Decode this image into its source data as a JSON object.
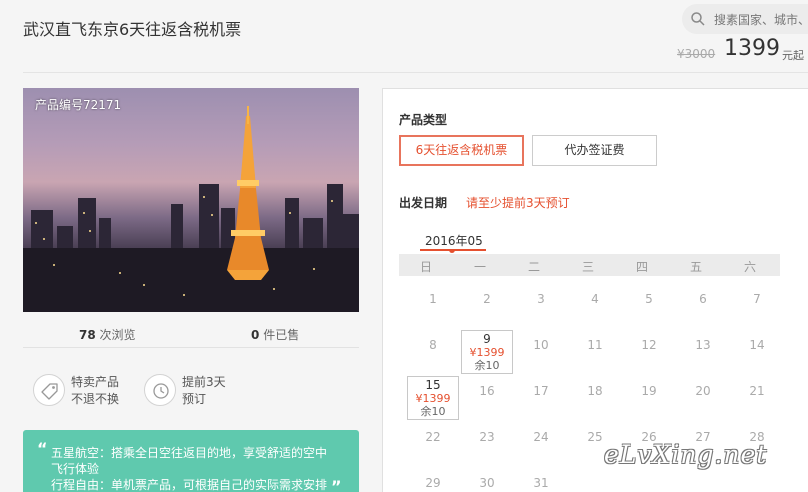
{
  "header": {
    "title": "武汉直飞东京6天往返含税机票",
    "search_placeholder": "搜素国家、城市、",
    "old_price": "¥3000",
    "price": "1399",
    "price_suffix": "元起"
  },
  "product": {
    "code_label": "产品编号72171",
    "views_count": "78",
    "views_label": "次浏览",
    "sold_count": "0",
    "sold_label": "件已售",
    "features": [
      {
        "icon": "tag-icon",
        "line1": "特卖产品",
        "line2": "不退不换"
      },
      {
        "icon": "clock-icon",
        "line1": "提前3天",
        "line2": "预订"
      }
    ],
    "promo": {
      "line1": "五星航空：搭乘全日空往返目的地，享受舒适的空中",
      "line2": "飞行体验",
      "line3": "行程自由：单机票产品，可根据自己的实际需求安排"
    }
  },
  "booking": {
    "type_label": "产品类型",
    "options": [
      "6天往返含税机票",
      "代办签证费"
    ],
    "selected_option": 0,
    "date_label": "出发日期",
    "date_notice": "请至少提前3天预订",
    "month": "2016年05",
    "weekdays": [
      "日",
      "一",
      "二",
      "三",
      "四",
      "五",
      "六"
    ],
    "rows": [
      [
        "1",
        "2",
        "3",
        "4",
        "5",
        "6",
        "7"
      ],
      [
        "8",
        "9",
        "10",
        "11",
        "12",
        "13",
        "14"
      ],
      [
        "15",
        "16",
        "17",
        "18",
        "19",
        "20",
        "21"
      ],
      [
        "22",
        "23",
        "24",
        "25",
        "26",
        "27",
        "28"
      ],
      [
        "29",
        "30",
        "31"
      ]
    ],
    "available": [
      {
        "day": "9",
        "price": "¥1399",
        "remain": "余10"
      },
      {
        "day": "15",
        "price": "¥1399",
        "remain": "余10"
      }
    ]
  },
  "watermark": "eLvXing.net",
  "colors": {
    "accent": "#e5502f",
    "promo_bg": "#5fc9ae"
  }
}
